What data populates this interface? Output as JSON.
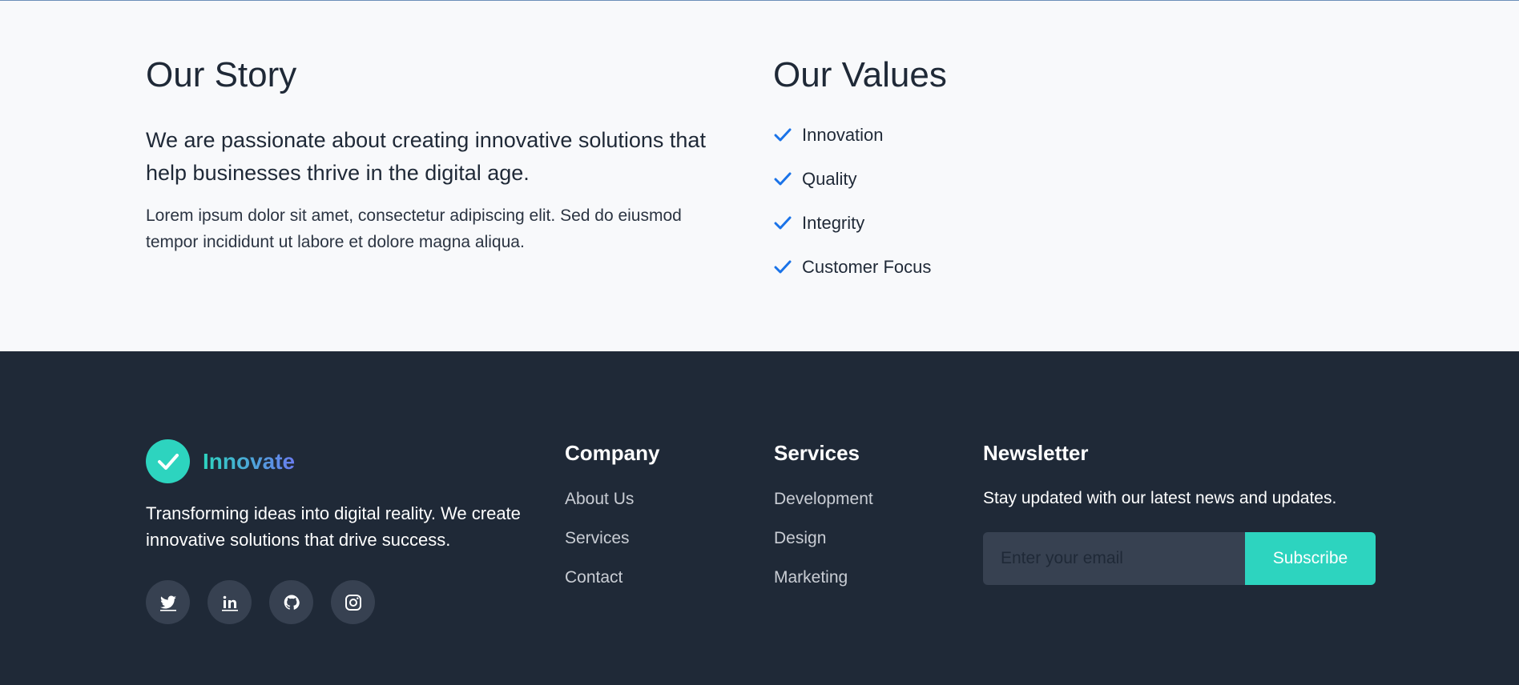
{
  "about": {
    "story": {
      "title": "Our Story",
      "lead": "We are passionate about creating innovative solutions that help businesses thrive in the digital age.",
      "body": "Lorem ipsum dolor sit amet, consectetur adipiscing elit. Sed do eiusmod tempor incididunt ut labore et dolore magna aliqua."
    },
    "values": {
      "title": "Our Values",
      "items": [
        "Innovation",
        "Quality",
        "Integrity",
        "Customer Focus"
      ],
      "check_icon": "check-icon",
      "check_color": "#1a73e8"
    }
  },
  "footer": {
    "brand": {
      "name": "Innovate",
      "logo_icon": "check-circle-icon",
      "logo_color": "#2dd4bf"
    },
    "tagline": "Transforming ideas into digital reality. We create innovative solutions that drive success.",
    "social": [
      "twitter-icon",
      "linkedin-icon",
      "github-icon",
      "instagram-icon"
    ],
    "company": {
      "title": "Company",
      "links": [
        "About Us",
        "Services",
        "Contact"
      ]
    },
    "services": {
      "title": "Services",
      "links": [
        "Development",
        "Design",
        "Marketing"
      ]
    },
    "newsletter": {
      "title": "Newsletter",
      "text": "Stay updated with our latest news and updates.",
      "email_placeholder": "Enter your email",
      "email_value": "",
      "subscribe_label": "Subscribe",
      "accent": "#2dd4bf"
    },
    "background": "#1f2937"
  }
}
